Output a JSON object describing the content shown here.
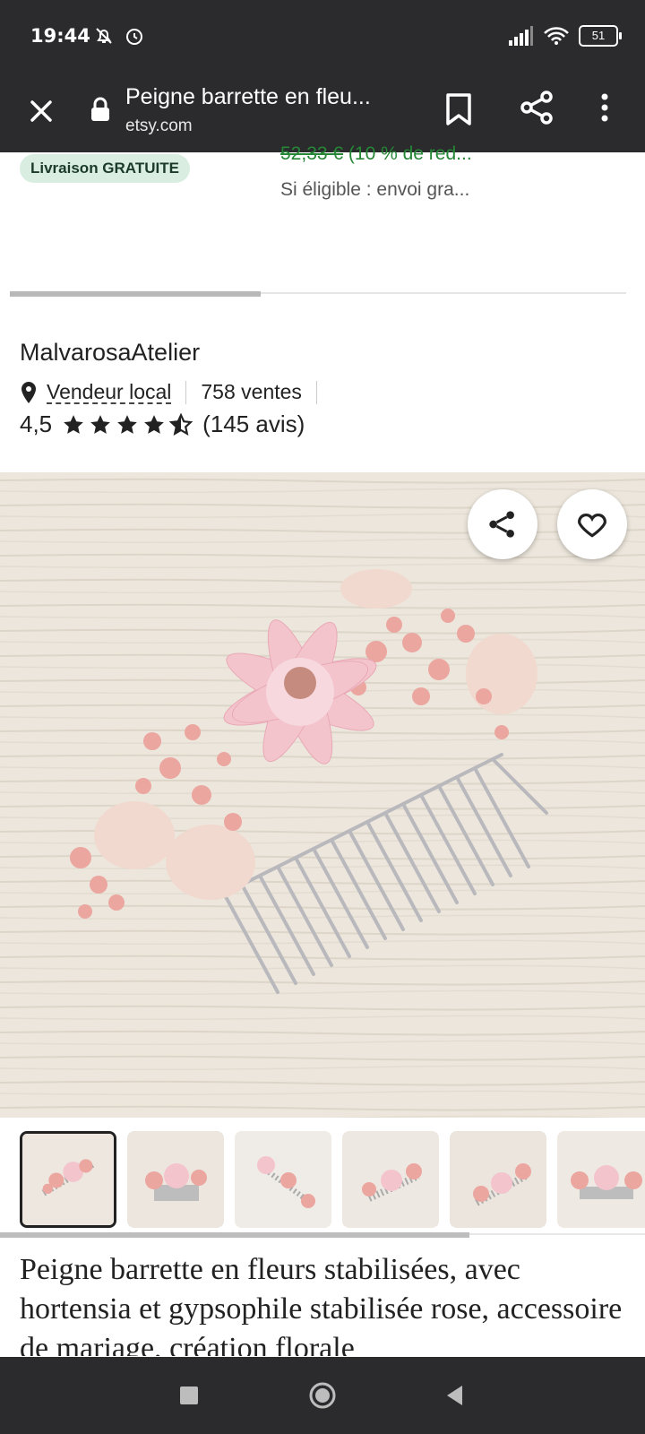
{
  "status_bar": {
    "time": "19:44",
    "battery": "51",
    "icons": [
      "silent-icon",
      "alarm-icon",
      "signal-icon",
      "wifi-icon",
      "battery-icon"
    ]
  },
  "browser": {
    "page_title": "Peigne barrette en fleu...",
    "url": "etsy.com"
  },
  "listing": {
    "free_shipping_badge": "Livraison GRATUITE",
    "discount_strike": "52,33 €",
    "discount_rest": " (10 % de red...",
    "shipping_note": "Si éligible : envoi gra..."
  },
  "shop": {
    "name": "MalvarosaAtelier",
    "local_seller": "Vendeur local",
    "sales": "758 ventes",
    "rating": "4,5",
    "rating_value": 4.5,
    "reviews": "(145 avis)"
  },
  "gallery": {
    "thumbnail_count": 6,
    "selected_index": 0
  },
  "product": {
    "title": "Peigne barrette en fleurs stabilisées, avec hortensia et gypsophile stabilisée rose, accessoire de mariage, création florale"
  },
  "colors": {
    "bar_background": "#2b2b2e",
    "badge_background": "#d9eee1",
    "discount_green": "#258635"
  }
}
